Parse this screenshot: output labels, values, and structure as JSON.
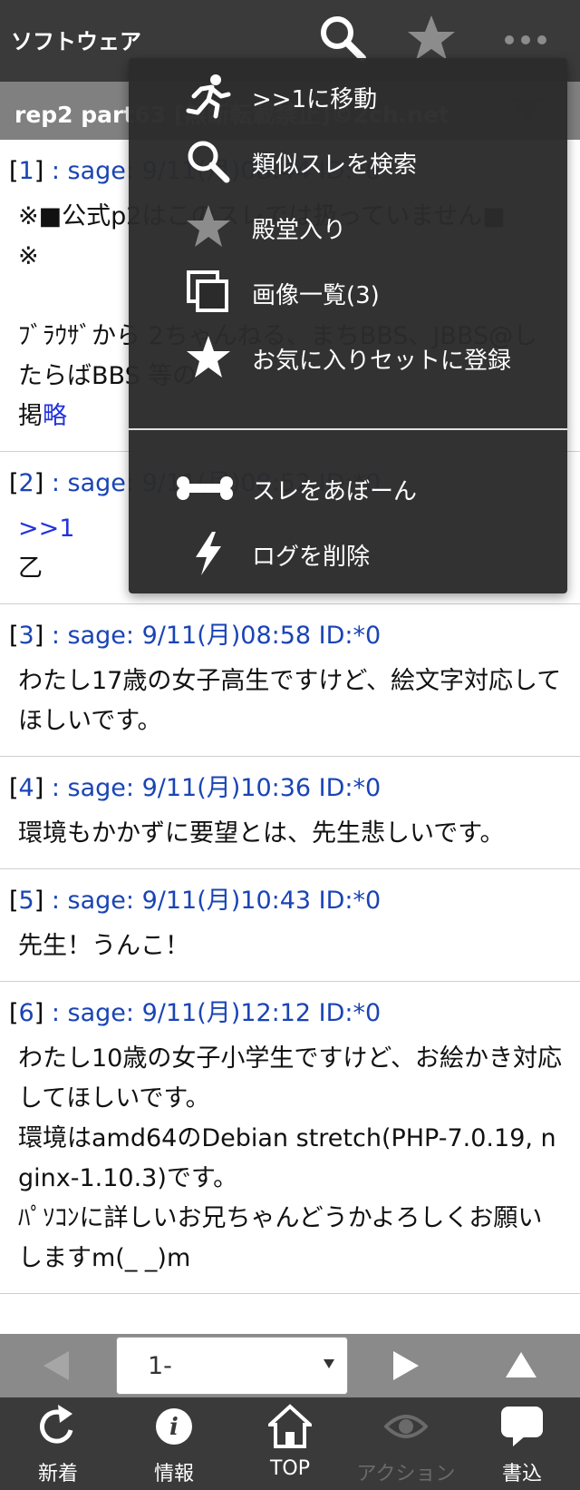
{
  "app": {
    "title": "ソフトウェア",
    "icons": [
      "search-icon",
      "star-icon",
      "more-icon"
    ]
  },
  "thread": {
    "title": "rep2 part63 [無断転載禁止]©2ch.net"
  },
  "posts": [
    {
      "num": "1",
      "meta": " : sage: 9/11(月)08:44 ID:*0",
      "body": "※■公式p2はこのスレでは扱っていません■\n※\n\nﾌﾞﾗｳｻﾞから 2ちゃんねる、まちBBS、JBBS@したらばBBS 等の\n掲",
      "more": "略"
    },
    {
      "num": "2",
      "meta": " : sage: 9/11(月)08:52 ID:*0",
      "anchor": ">>1",
      "body": "乙"
    },
    {
      "num": "3",
      "meta": " : sage: 9/11(月)08:58 ID:*0",
      "body": "わたし17歳の女子高生ですけど、絵文字対応してほしいです。"
    },
    {
      "num": "4",
      "meta": " : sage: 9/11(月)10:36 ID:*0",
      "body": "環境もかかずに要望とは、先生悲しいです。"
    },
    {
      "num": "5",
      "meta": " : sage: 9/11(月)10:43 ID:*0",
      "body": "先生！うんこ！"
    },
    {
      "num": "6",
      "meta": " : sage: 9/11(月)12:12 ID:*0",
      "body": "わたし10歳の女子小学生ですけど、お絵かき対応してほしいです。\n環境はamd64のDebian stretch(PHP-7.0.19, nginx-1.10.3)です。\nﾊﾟｿｺﾝに詳しいお兄ちゃんどうかよろしくお願いしますm(_ _)m"
    }
  ],
  "menu": {
    "items": [
      {
        "icon": "running-man-icon",
        "label": ">>1に移動"
      },
      {
        "icon": "search-icon",
        "label": "類似スレを検索"
      },
      {
        "icon": "star-icon",
        "label": "殿堂入り"
      },
      {
        "icon": "copy-icon",
        "label": "画像一覧(3)"
      },
      {
        "icon": "star-icon",
        "label": "お気に入りセットに登録"
      },
      {
        "icon": "bone-icon",
        "label": "スレをあぼーん"
      },
      {
        "icon": "lightning-icon",
        "label": "ログを削除"
      }
    ]
  },
  "pager": {
    "selected": "1-"
  },
  "nav": {
    "items": [
      {
        "icon": "refresh-icon",
        "label": "新着",
        "disabled": false
      },
      {
        "icon": "info-icon",
        "label": "情報",
        "disabled": false
      },
      {
        "icon": "home-icon",
        "label": "TOP",
        "disabled": false
      },
      {
        "icon": "eye-icon",
        "label": "アクション",
        "disabled": true
      },
      {
        "icon": "chat-icon",
        "label": "書込",
        "disabled": false
      }
    ]
  },
  "colors": {
    "topbar": "#3a3a3a",
    "thread_bar": "#808080",
    "link": "#1a44b5",
    "menu_bg": "#2b2b2b"
  }
}
